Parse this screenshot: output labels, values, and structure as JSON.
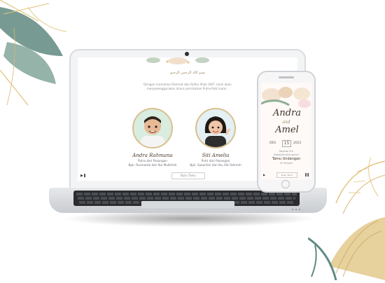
{
  "laptop_page": {
    "arabic_greeting": "بسم الله الرحمن الرحيم",
    "intro_text": "Dengan memohon Rahmat dan Ridho Allah SWT, kami akan menyelenggarakan Acara pernikahan Putra-Putri kami :",
    "groom": {
      "name": "Andra Rahmana",
      "line1": "Putra dari Pasangan",
      "line2": "Bpk. Rusmanto dan Ibu Mulikhah"
    },
    "bride": {
      "name": "Siti Amelia",
      "line1": "Putri dari Pasangan",
      "line2": "Bpk. Sukardini dan Ibu Siti Fatimah"
    },
    "bottom_label": "Buku Tamu",
    "play_icon": "play-icon",
    "qr_icon": "qr-icon"
  },
  "phone_page": {
    "groom_first": "Andra",
    "and_word": "and",
    "bride_first": "Amel",
    "date_day_left": "DES",
    "date_day": "15",
    "date_year": "2021",
    "guest_label": "Kepada Yth",
    "guest_sub": "Bapak/Ibu/Saudara/i",
    "guest_name": "Tamu Undangan",
    "guest_loc": "Di Tempat",
    "bottom_label": "Buku Tamu"
  },
  "colors": {
    "gold": "#d9c08f",
    "leaf_green": "#6b8f7e",
    "leaf_gold": "#e2c27a",
    "text_dark": "#3e3328"
  }
}
